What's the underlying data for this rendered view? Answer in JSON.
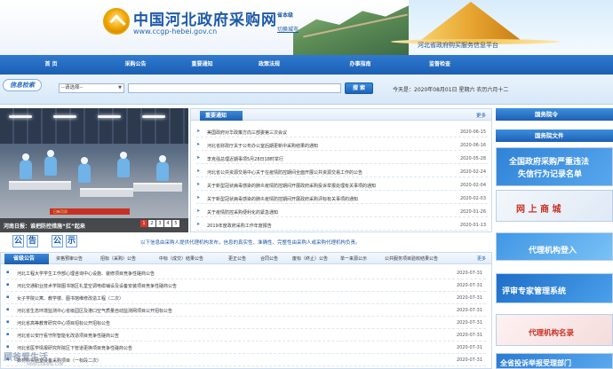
{
  "header": {
    "title": "中国河北政府采购网",
    "url": "www.ccgp-hebei.gov.cn",
    "province_tag": "省本级",
    "city_link": "切换城市",
    "platform": "河北省政府购买服务信息平台"
  },
  "nav": {
    "items": [
      "首 页",
      "采购公告",
      "重要通知",
      "政策法规",
      "办事指南",
      "监督检查"
    ]
  },
  "search": {
    "badge": "信息检索",
    "select_value": "--请选择--",
    "input_value": "",
    "button_label": "搜 索",
    "today": "今天是：2020年08月01日 星期六 农历六月十二"
  },
  "slideshow": {
    "banner_text": "日新月异",
    "caption": "河南日报：谁把防控措施“扛”起来",
    "dots": [
      "1",
      "2",
      "3",
      "4",
      "5"
    ],
    "active_dot": 0
  },
  "notices": {
    "tab_label": "重要通知",
    "more_label": "更多",
    "items": [
      {
        "title": "美国政府对华政策方向三部委第三次会议",
        "date": "2020-06-15"
      },
      {
        "title": "河北省财政厅关于公布办公室后期更新中采购结果的通知",
        "date": "2020-06-16"
      },
      {
        "title": "李克强总理近期事项5月28日18时举行",
        "date": "2020-05-28"
      },
      {
        "title": "河北省公共资源交易中心关于在疫情防控期间全面开展公共资源交易工作的公告",
        "date": "2020-02-24"
      },
      {
        "title": "关于新型冠状病毒感染的肺炎疫情防控期间开展政府采购投诉举报处理有关事项的通知",
        "date": "2020-02-04"
      },
      {
        "title": "关于新型冠状病毒感染的肺炎疫情防控期间开展政府采购评标有关事项的通知",
        "date": "2020-02-03"
      },
      {
        "title": "关于疫情防控采购便利化的紧急通知",
        "date": "2020-01-26"
      },
      {
        "title": "2019年度政府采购工作年度报告",
        "date": "2020-01-13"
      }
    ]
  },
  "announce": {
    "chars": [
      "公",
      "告",
      "公",
      "示"
    ],
    "text": "以下信息由采购人提供代理机构发布，信息的真实性、准确性、完整性由采购人或采购代理机构负责。"
  },
  "procurement": {
    "active_tab": "省级公告",
    "tabs": [
      "资格预审公告",
      "招标（采购）公告",
      "中标（成交）结果公告",
      "更正公告",
      "合同公告",
      "废标（终止）公告",
      "单一来源公示",
      "公共服务项目验收结果公告"
    ],
    "more_label": "更多",
    "items": [
      {
        "title": "河北工程大学学生工作部心理咨询中心设施、装修项目竞争性磋商公告",
        "date": "2020-07-31"
      },
      {
        "title": "河北交通职业技术学院图书馆区礼堂空调电缆铺设及设备安装项目竞争性磋商公告",
        "date": "2020-07-31"
      },
      {
        "title": "女子学院公寓、教学楼、图书馆维修改造工程（二次）",
        "date": "2020-07-31"
      },
      {
        "title": "河北省生态环境监测中心省级园区及港口空气质量自动监测网项目公开招标公告",
        "date": "2020-07-31"
      },
      {
        "title": "河北省高等教育研究中心项目招标公开招标公告",
        "date": "2020-07-31"
      },
      {
        "title": "河北省公安厅看守所智能化改造项目竞争性磋商公告",
        "date": "2020-07-31"
      },
      {
        "title": "河北省医学情报研究所院区下管道更换项目竞争性磋商公告",
        "date": "2020-07-31"
      },
      {
        "title": "数材料实验室设备采购项目（一标段二次）",
        "date": "2020-07-31"
      }
    ]
  },
  "watermark": {
    "text": "顾爸爱生活",
    "sub": "WWW.GUBAIKE.COM"
  },
  "right": {
    "head1": "国务院令",
    "head2": "国务院文件",
    "banners": [
      {
        "line1": "全国政府采购严重违法",
        "line2": "失信行为记录名单"
      },
      {
        "line1": "网 上 商 城",
        "line2": ""
      },
      {
        "line1": "代理机构登入",
        "line2": ""
      },
      {
        "line1": "评审专家管理系统",
        "line2": ""
      },
      {
        "line1": "代理机构名录",
        "line2": ""
      },
      {
        "line1": "全省投诉举报受理部门",
        "line2": ""
      }
    ]
  },
  "colors": {
    "primary": "#1e5aa8",
    "nav": "#1b5fb4",
    "accent_red": "#c83023",
    "gold": "#f0a500"
  }
}
